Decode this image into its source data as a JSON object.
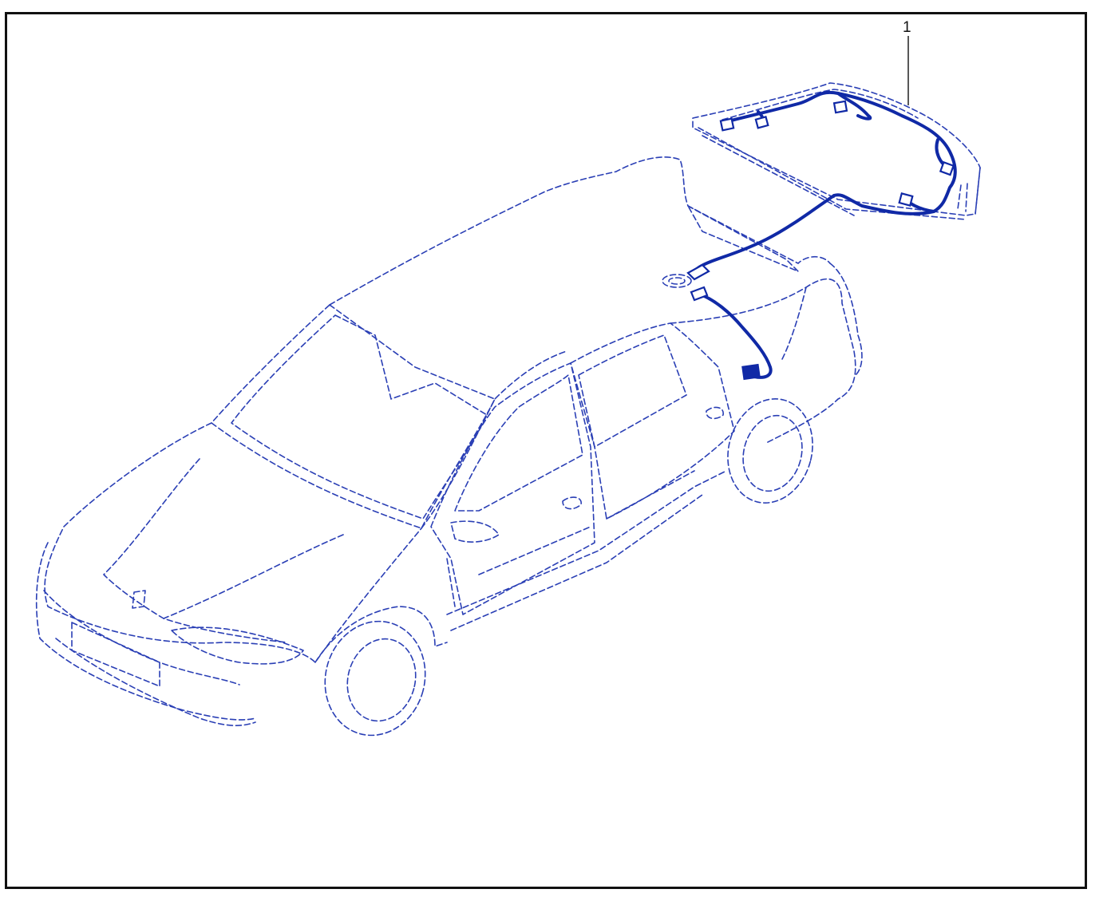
{
  "callouts": [
    {
      "label": "1"
    }
  ],
  "colors": {
    "ghost_outline": "#2a3fb5",
    "harness": "#1029a6",
    "frame": "#111111"
  }
}
